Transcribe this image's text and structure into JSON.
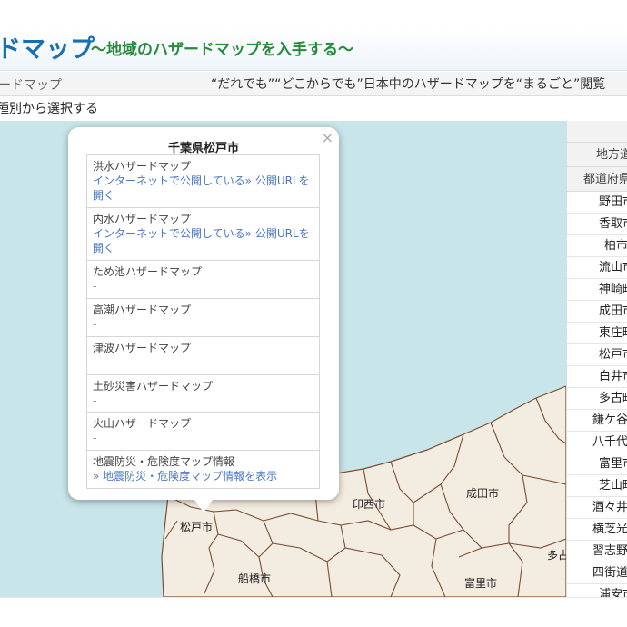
{
  "header": {
    "title": "ドマップ",
    "subtitle": "～地域のハザードマップを入手する～"
  },
  "subheader": {
    "crumb": "ードマップ",
    "tagline": "“だれでも”“どこからでも”日本中のハザードマップを“まるごと”閲覧"
  },
  "selector": {
    "label": "種別から選択する"
  },
  "popup": {
    "title": "千葉県松戸市",
    "close_glyph": "×",
    "items": [
      {
        "name": "洪水ハザードマップ",
        "link1": "インターネットで公開している»",
        "link2": "公開URLを開く"
      },
      {
        "name": "内水ハザードマップ",
        "link1": "インターネットで公開している»",
        "link2": "公開URLを開く"
      },
      {
        "name": "ため池ハザードマップ",
        "value": "-"
      },
      {
        "name": "高潮ハザードマップ",
        "value": "-"
      },
      {
        "name": "津波ハザードマップ",
        "value": "-"
      },
      {
        "name": "土砂災害ハザードマップ",
        "value": "-"
      },
      {
        "name": "火山ハザードマップ",
        "value": "-"
      },
      {
        "name": "地震防災・危険度マップ情報",
        "link1": "» 地震防災・危険度マップ情報を表示"
      }
    ]
  },
  "map_labels": {
    "matsudo": "松戸市",
    "inzai": "印西市",
    "narita": "成田市",
    "funabashi": "船橋市",
    "tomisato": "富里市",
    "tako": "多古"
  },
  "side_table": {
    "col1": "地方道",
    "col2": "都道府県",
    "rows": [
      "野田市",
      "香取市",
      "柏市",
      "流山市",
      "神崎町",
      "成田市",
      "東庄町",
      "松戸市",
      "白井市",
      "多古町",
      "鎌ケ谷市",
      "八千代市",
      "富里市",
      "芝山町",
      "酒々井町",
      "横芝光町",
      "習志野市",
      "四街道市",
      "浦安市"
    ]
  },
  "colors": {
    "sea": "#c8e5ea",
    "land": "#f3ece0",
    "boundary": "#7a4e33",
    "title_blue": "#1a6fb0",
    "subtitle_green": "#2a8a3c",
    "link_blue": "#4a78c2"
  }
}
